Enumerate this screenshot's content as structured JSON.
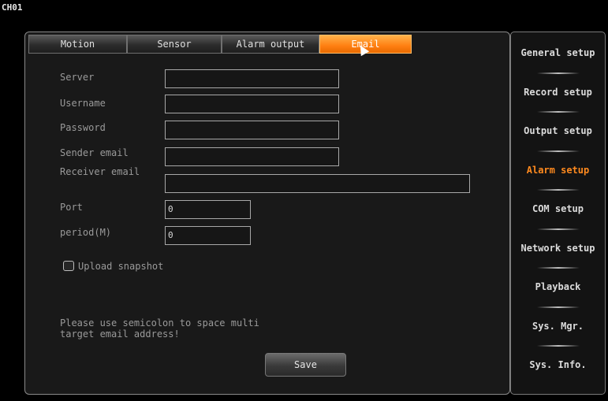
{
  "channel": "CH01",
  "tabs": [
    {
      "label": "Motion",
      "active": false
    },
    {
      "label": "Sensor",
      "active": false
    },
    {
      "label": "Alarm output",
      "active": false
    },
    {
      "label": "Email",
      "active": true
    }
  ],
  "form": {
    "server": {
      "label": "Server",
      "value": ""
    },
    "username": {
      "label": "Username",
      "value": ""
    },
    "password": {
      "label": "Password",
      "value": ""
    },
    "sender_email": {
      "label": "Sender email",
      "value": ""
    },
    "receiver_email": {
      "label": "Receiver email",
      "value": ""
    },
    "port": {
      "label": "Port",
      "value": "0"
    },
    "period": {
      "label": "period(M)",
      "value": "0"
    },
    "upload_snapshot": {
      "label": "Upload snapshot",
      "checked": false
    }
  },
  "note": {
    "line1": "Please use semicolon to space multi",
    "line2": "target email address!"
  },
  "save_label": "Save",
  "sidebar": {
    "items": [
      {
        "label": "General setup",
        "active": false
      },
      {
        "label": "Record setup",
        "active": false
      },
      {
        "label": "Output setup",
        "active": false
      },
      {
        "label": "Alarm setup",
        "active": true
      },
      {
        "label": "COM setup",
        "active": false
      },
      {
        "label": "Network setup",
        "active": false
      },
      {
        "label": "Playback",
        "active": false
      },
      {
        "label": "Sys. Mgr.",
        "active": false
      },
      {
        "label": "Sys. Info.",
        "active": false
      }
    ]
  },
  "colors": {
    "accent": "#ff8a1e",
    "tab_active": "#ff7f12",
    "background": "#000000",
    "panel": "#191919"
  }
}
